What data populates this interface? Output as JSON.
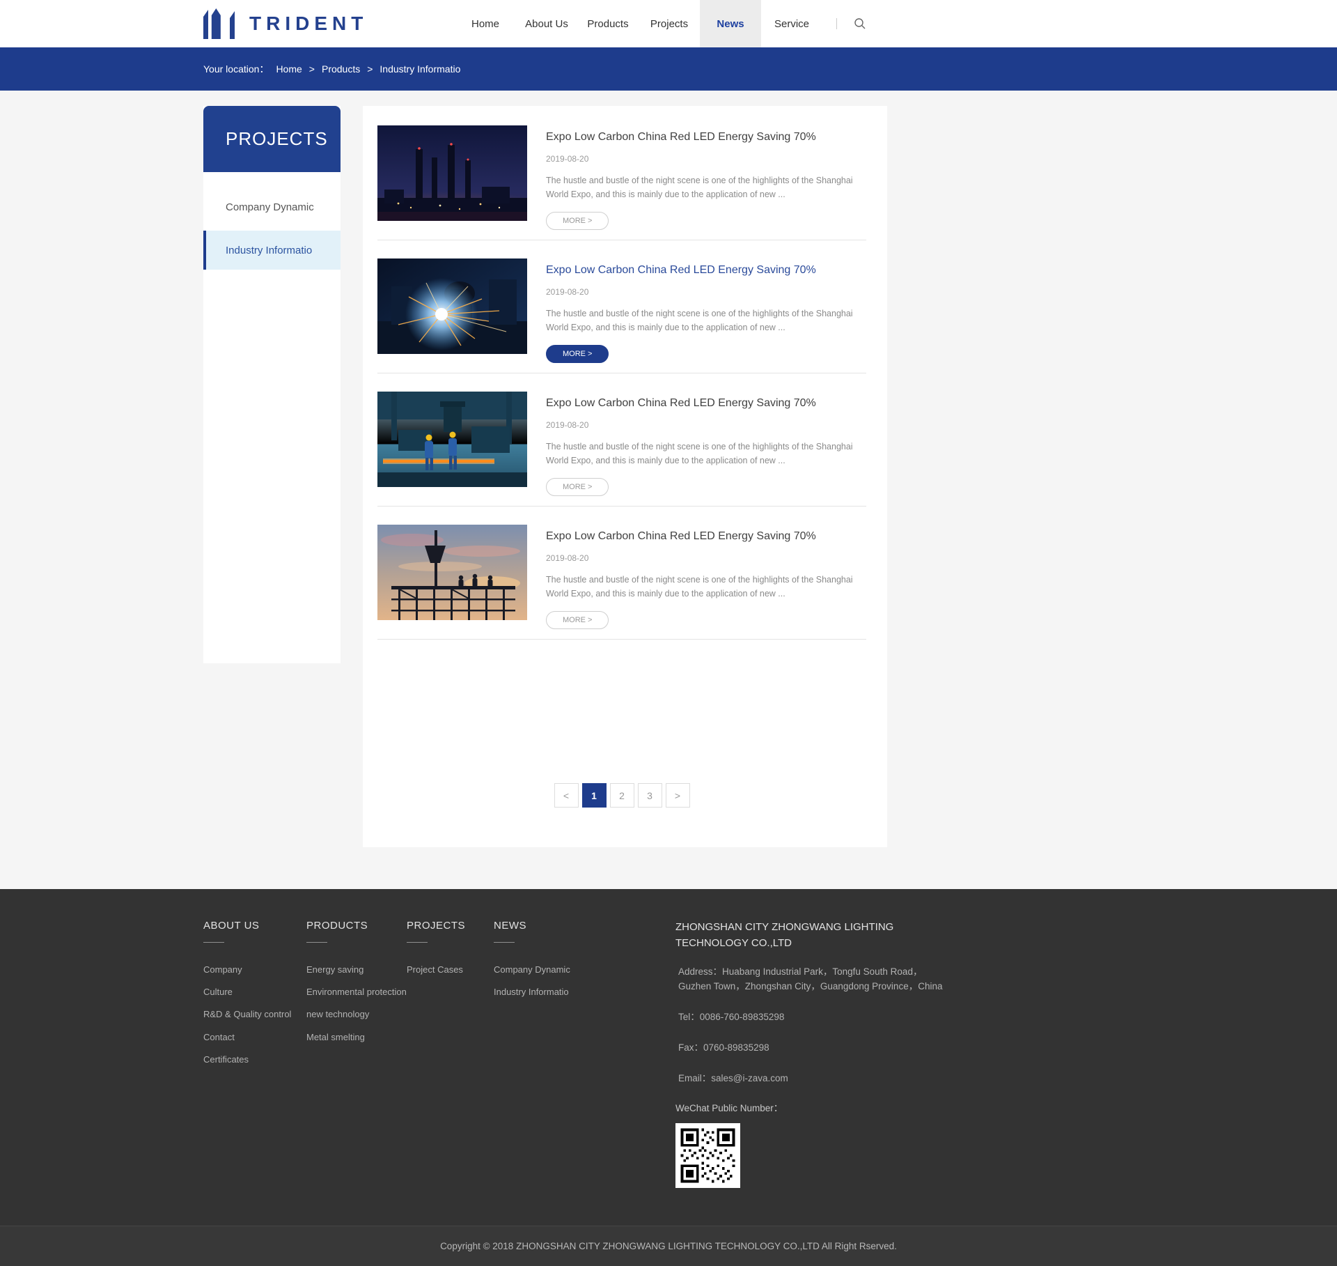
{
  "header": {
    "logo_text": "TRIDENT",
    "nav": [
      {
        "label": "Home"
      },
      {
        "label": "About Us"
      },
      {
        "label": "Products"
      },
      {
        "label": "Projects"
      },
      {
        "label": "News",
        "active": true
      },
      {
        "label": "Service"
      }
    ],
    "search_icon": "search-icon"
  },
  "breadcrumb": {
    "label": "Your location：",
    "home": "Home",
    "sep": ">",
    "products": "Products",
    "current": "Industry Informatio"
  },
  "sidebar": {
    "title": "PROJECTS",
    "items": [
      {
        "label": "Company Dynamic",
        "active": false
      },
      {
        "label": "Industry Informatio",
        "active": true
      }
    ]
  },
  "news": {
    "items": [
      {
        "image": "night-power-plant",
        "title": "Expo Low Carbon China Red LED Energy Saving 70%",
        "date": "2019-08-20",
        "excerpt": "The hustle and bustle of the night scene is one of the highlights of the Shanghai World Expo, and this is mainly due to the application of new ...",
        "more": "MORE >",
        "highlighted": false
      },
      {
        "image": "welding-sparks",
        "title": "Expo Low Carbon China Red LED Energy Saving 70%",
        "date": "2019-08-20",
        "excerpt": "The hustle and bustle of the night scene is one of the highlights of the Shanghai World Expo, and this is mainly due to the application of new ...",
        "more": "MORE >",
        "highlighted": true
      },
      {
        "image": "factory-workers",
        "title": "Expo Low Carbon China Red LED Energy Saving 70%",
        "date": "2019-08-20",
        "excerpt": "The hustle and bustle of the night scene is one of the highlights of the Shanghai World Expo, and this is mainly due to the application of new ...",
        "more": "MORE >",
        "highlighted": false
      },
      {
        "image": "construction-silhouette",
        "title": "Expo Low Carbon China Red LED Energy Saving 70%",
        "date": "2019-08-20",
        "excerpt": "The hustle and bustle of the night scene is one of the highlights of the Shanghai World Expo, and this is mainly due to the application of new ...",
        "more": "MORE >",
        "highlighted": false
      }
    ]
  },
  "pagination": {
    "prev": "<",
    "pages": [
      "1",
      "2",
      "3"
    ],
    "current": "1",
    "next": ">"
  },
  "footer": {
    "columns": [
      {
        "title": "ABOUT US",
        "links": [
          "Company",
          "Culture",
          "R&D & Quality control",
          "Contact",
          "Certificates"
        ]
      },
      {
        "title": "PRODUCTS",
        "links": [
          "Energy saving",
          "Environmental protection",
          "new technology",
          "Metal smelting"
        ]
      },
      {
        "title": "PROJECTS",
        "links": [
          "Project Cases"
        ]
      },
      {
        "title": "NEWS",
        "links": [
          "Company Dynamic",
          "Industry Informatio"
        ]
      }
    ],
    "company": {
      "name": "ZHONGSHAN CITY ZHONGWANG LIGHTING TECHNOLOGY CO.,LTD",
      "address": "Address：Huabang Industrial Park，Tongfu South Road，Guzhen Town，Zhongshan City，Guangdong Province，China",
      "tel": "Tel：0086-760-89835298",
      "fax": "Fax：0760-89835298",
      "email": "Email：sales@i-zava.com",
      "wechat_label": "WeChat Public Number："
    },
    "copyright": "Copyright © 2018 ZHONGSHAN CITY ZHONGWANG LIGHTING TECHNOLOGY CO.,LTD All Right Rserved."
  },
  "colors": {
    "primary_blue": "#1e3c8c",
    "logo_blue": "#24418e",
    "nav_active_bg": "#ececec",
    "sidebar_active_bg": "#e2f1f9",
    "page_bg": "#f5f5f5",
    "footer_bg": "#333333"
  }
}
